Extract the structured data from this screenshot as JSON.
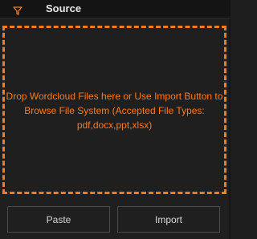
{
  "header": {
    "title": "Source",
    "filter_icon": "filter-icon",
    "accent": "#ff7a1a"
  },
  "drop_zone": {
    "message": "Drop Wordcloud Files here or Use Import Button to Browse File System (Accepted File Types: pdf,docx,ppt,xlsx)",
    "border_color": "#ff7a1a"
  },
  "buttons": {
    "paste_label": "Paste",
    "import_label": "Import"
  }
}
